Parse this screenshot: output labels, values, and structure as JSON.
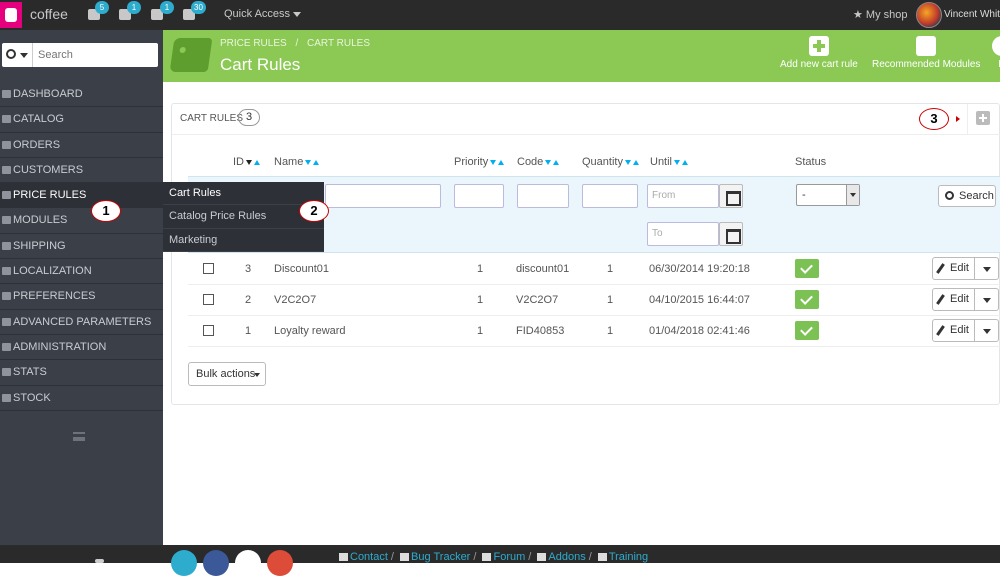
{
  "topbar": {
    "brand": "coffee",
    "badges": {
      "orders": "5",
      "customers": "1",
      "messages": "1",
      "trophy": "30"
    },
    "quick_access": "Quick Access",
    "my_shop": "My shop",
    "user_name": "Vincent Whit"
  },
  "sidebar": {
    "search_placeholder": "Search",
    "items": [
      {
        "label": "DASHBOARD"
      },
      {
        "label": "CATALOG"
      },
      {
        "label": "ORDERS"
      },
      {
        "label": "CUSTOMERS"
      },
      {
        "label": "PRICE RULES"
      },
      {
        "label": "MODULES"
      },
      {
        "label": "SHIPPING"
      },
      {
        "label": "LOCALIZATION"
      },
      {
        "label": "PREFERENCES"
      },
      {
        "label": "ADVANCED PARAMETERS"
      },
      {
        "label": "ADMINISTRATION"
      },
      {
        "label": "STATS"
      },
      {
        "label": "STOCK"
      }
    ],
    "flyout": [
      "Cart Rules",
      "Catalog Price Rules",
      "Marketing"
    ]
  },
  "header": {
    "breadcrumb_1": "PRICE RULES",
    "breadcrumb_sep": "/",
    "breadcrumb_2": "CART RULES",
    "title": "Cart Rules",
    "toolbar": {
      "add": "Add new cart rule",
      "recommended": "Recommended Modules",
      "help": "H"
    }
  },
  "panel": {
    "title": "CART RULES",
    "count": "3",
    "columns": [
      "ID",
      "Name",
      "Priority",
      "Code",
      "Quantity",
      "Until",
      "Status"
    ],
    "filters": {
      "from_placeholder": "From",
      "to_placeholder": "To",
      "status_value": "-",
      "search_label": "Search"
    },
    "rows": [
      {
        "id": "3",
        "name": "Discount01",
        "priority": "1",
        "code": "discount01",
        "quantity": "1",
        "until": "06/30/2014 19:20:18"
      },
      {
        "id": "2",
        "name": "V2C2O7",
        "priority": "1",
        "code": "V2C2O7",
        "quantity": "1",
        "until": "04/10/2015 16:44:07"
      },
      {
        "id": "1",
        "name": "Loyalty reward",
        "priority": "1",
        "code": "FID40853",
        "quantity": "1",
        "until": "01/04/2018 02:41:46"
      }
    ],
    "edit_label": "Edit",
    "bulk_actions": "Bulk actions"
  },
  "callouts": [
    "1",
    "2",
    "3"
  ],
  "footer": {
    "links": [
      "Contact",
      "Bug Tracker",
      "Forum",
      "Addons",
      "Training"
    ],
    "sep": "/"
  },
  "colors": {
    "accent_green": "#8bc954",
    "sidebar": "#3b3f48",
    "topbar": "#2a2a2a",
    "link_blue": "#2eacce",
    "status_green": "#7cc153",
    "callout_red": "#cc0000"
  }
}
